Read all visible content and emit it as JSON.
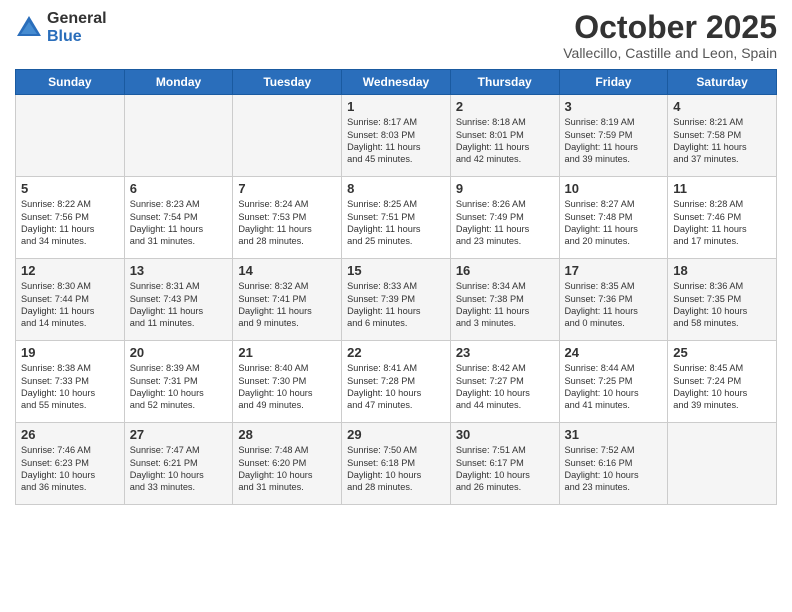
{
  "logo": {
    "general": "General",
    "blue": "Blue"
  },
  "title": "October 2025",
  "subtitle": "Vallecillo, Castille and Leon, Spain",
  "days_header": [
    "Sunday",
    "Monday",
    "Tuesday",
    "Wednesday",
    "Thursday",
    "Friday",
    "Saturday"
  ],
  "weeks": [
    [
      {
        "day": "",
        "info": ""
      },
      {
        "day": "",
        "info": ""
      },
      {
        "day": "",
        "info": ""
      },
      {
        "day": "1",
        "info": "Sunrise: 8:17 AM\nSunset: 8:03 PM\nDaylight: 11 hours\nand 45 minutes."
      },
      {
        "day": "2",
        "info": "Sunrise: 8:18 AM\nSunset: 8:01 PM\nDaylight: 11 hours\nand 42 minutes."
      },
      {
        "day": "3",
        "info": "Sunrise: 8:19 AM\nSunset: 7:59 PM\nDaylight: 11 hours\nand 39 minutes."
      },
      {
        "day": "4",
        "info": "Sunrise: 8:21 AM\nSunset: 7:58 PM\nDaylight: 11 hours\nand 37 minutes."
      }
    ],
    [
      {
        "day": "5",
        "info": "Sunrise: 8:22 AM\nSunset: 7:56 PM\nDaylight: 11 hours\nand 34 minutes."
      },
      {
        "day": "6",
        "info": "Sunrise: 8:23 AM\nSunset: 7:54 PM\nDaylight: 11 hours\nand 31 minutes."
      },
      {
        "day": "7",
        "info": "Sunrise: 8:24 AM\nSunset: 7:53 PM\nDaylight: 11 hours\nand 28 minutes."
      },
      {
        "day": "8",
        "info": "Sunrise: 8:25 AM\nSunset: 7:51 PM\nDaylight: 11 hours\nand 25 minutes."
      },
      {
        "day": "9",
        "info": "Sunrise: 8:26 AM\nSunset: 7:49 PM\nDaylight: 11 hours\nand 23 minutes."
      },
      {
        "day": "10",
        "info": "Sunrise: 8:27 AM\nSunset: 7:48 PM\nDaylight: 11 hours\nand 20 minutes."
      },
      {
        "day": "11",
        "info": "Sunrise: 8:28 AM\nSunset: 7:46 PM\nDaylight: 11 hours\nand 17 minutes."
      }
    ],
    [
      {
        "day": "12",
        "info": "Sunrise: 8:30 AM\nSunset: 7:44 PM\nDaylight: 11 hours\nand 14 minutes."
      },
      {
        "day": "13",
        "info": "Sunrise: 8:31 AM\nSunset: 7:43 PM\nDaylight: 11 hours\nand 11 minutes."
      },
      {
        "day": "14",
        "info": "Sunrise: 8:32 AM\nSunset: 7:41 PM\nDaylight: 11 hours\nand 9 minutes."
      },
      {
        "day": "15",
        "info": "Sunrise: 8:33 AM\nSunset: 7:39 PM\nDaylight: 11 hours\nand 6 minutes."
      },
      {
        "day": "16",
        "info": "Sunrise: 8:34 AM\nSunset: 7:38 PM\nDaylight: 11 hours\nand 3 minutes."
      },
      {
        "day": "17",
        "info": "Sunrise: 8:35 AM\nSunset: 7:36 PM\nDaylight: 11 hours\nand 0 minutes."
      },
      {
        "day": "18",
        "info": "Sunrise: 8:36 AM\nSunset: 7:35 PM\nDaylight: 10 hours\nand 58 minutes."
      }
    ],
    [
      {
        "day": "19",
        "info": "Sunrise: 8:38 AM\nSunset: 7:33 PM\nDaylight: 10 hours\nand 55 minutes."
      },
      {
        "day": "20",
        "info": "Sunrise: 8:39 AM\nSunset: 7:31 PM\nDaylight: 10 hours\nand 52 minutes."
      },
      {
        "day": "21",
        "info": "Sunrise: 8:40 AM\nSunset: 7:30 PM\nDaylight: 10 hours\nand 49 minutes."
      },
      {
        "day": "22",
        "info": "Sunrise: 8:41 AM\nSunset: 7:28 PM\nDaylight: 10 hours\nand 47 minutes."
      },
      {
        "day": "23",
        "info": "Sunrise: 8:42 AM\nSunset: 7:27 PM\nDaylight: 10 hours\nand 44 minutes."
      },
      {
        "day": "24",
        "info": "Sunrise: 8:44 AM\nSunset: 7:25 PM\nDaylight: 10 hours\nand 41 minutes."
      },
      {
        "day": "25",
        "info": "Sunrise: 8:45 AM\nSunset: 7:24 PM\nDaylight: 10 hours\nand 39 minutes."
      }
    ],
    [
      {
        "day": "26",
        "info": "Sunrise: 7:46 AM\nSunset: 6:23 PM\nDaylight: 10 hours\nand 36 minutes."
      },
      {
        "day": "27",
        "info": "Sunrise: 7:47 AM\nSunset: 6:21 PM\nDaylight: 10 hours\nand 33 minutes."
      },
      {
        "day": "28",
        "info": "Sunrise: 7:48 AM\nSunset: 6:20 PM\nDaylight: 10 hours\nand 31 minutes."
      },
      {
        "day": "29",
        "info": "Sunrise: 7:50 AM\nSunset: 6:18 PM\nDaylight: 10 hours\nand 28 minutes."
      },
      {
        "day": "30",
        "info": "Sunrise: 7:51 AM\nSunset: 6:17 PM\nDaylight: 10 hours\nand 26 minutes."
      },
      {
        "day": "31",
        "info": "Sunrise: 7:52 AM\nSunset: 6:16 PM\nDaylight: 10 hours\nand 23 minutes."
      },
      {
        "day": "",
        "info": ""
      }
    ]
  ]
}
